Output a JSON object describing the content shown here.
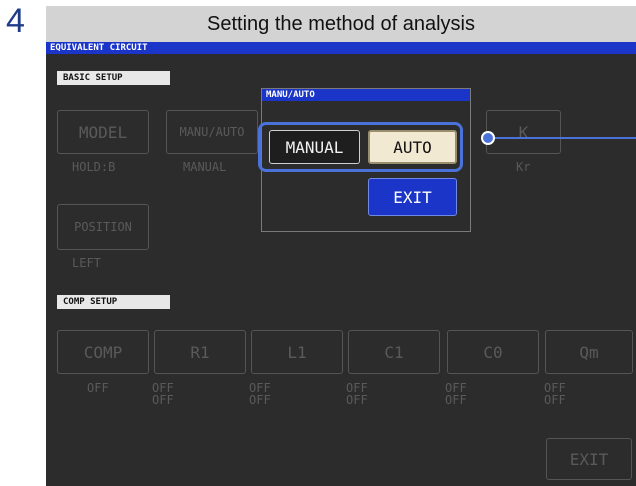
{
  "step": {
    "number": "4",
    "title": "Setting the method of analysis"
  },
  "screen": {
    "title": "EQUIVALENT CIRCUIT",
    "basic_setup": {
      "label": "BASIC SETUP",
      "buttons": [
        {
          "label": "MODEL",
          "value": "HOLD:B"
        },
        {
          "label": "MANU/AUTO",
          "value": "MANUAL"
        },
        {
          "label": "K",
          "value": "Kr"
        },
        {
          "label": "POSITION",
          "value": "LEFT"
        }
      ]
    },
    "comp_setup": {
      "label": "COMP SETUP",
      "buttons": [
        {
          "label": "COMP",
          "value": "OFF",
          "value2": ""
        },
        {
          "label": "R1",
          "value": "OFF",
          "value2": "OFF"
        },
        {
          "label": "L1",
          "value": "OFF",
          "value2": "OFF"
        },
        {
          "label": "C1",
          "value": "OFF",
          "value2": "OFF"
        },
        {
          "label": "C0",
          "value": "OFF",
          "value2": "OFF"
        },
        {
          "label": "Qm",
          "value": "OFF",
          "value2": "OFF"
        }
      ]
    },
    "exit_label": "EXIT"
  },
  "popup": {
    "title": "MANU/AUTO",
    "manual_label": "MANUAL",
    "auto_label": "AUTO",
    "exit_label": "EXIT",
    "selected": "AUTO"
  },
  "colors": {
    "title_bar": "#1a35c8",
    "highlight": "#4a72d9",
    "selected_button": "#f1e9d2",
    "screen_bg": "#2c2c2c"
  }
}
